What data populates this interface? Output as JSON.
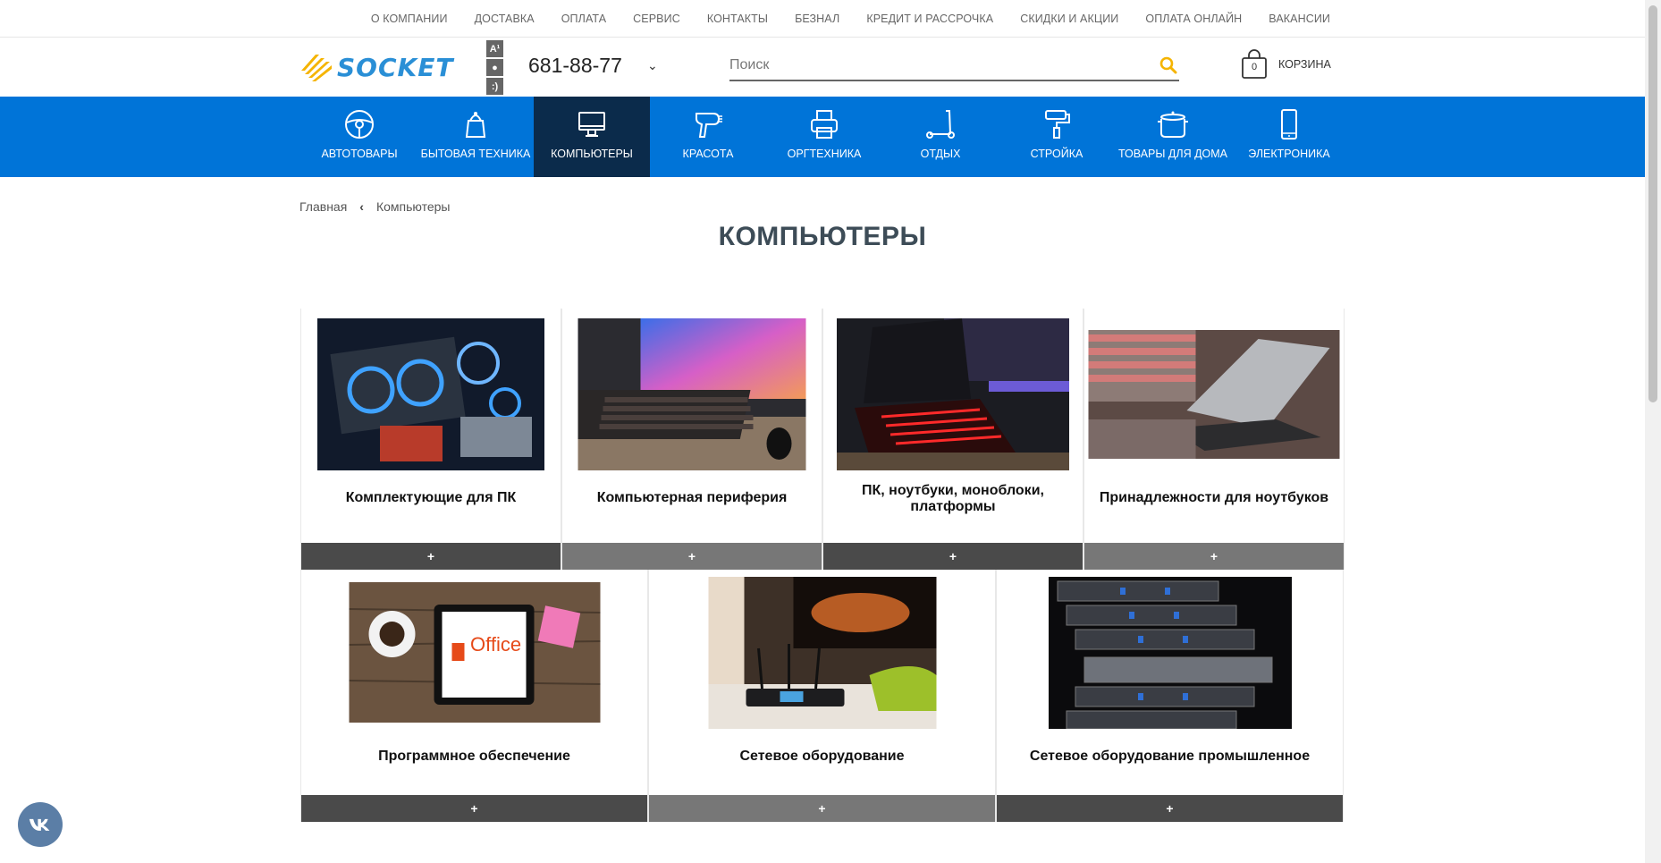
{
  "top_links": [
    "О КОМПАНИИ",
    "ДОСТАВКА",
    "ОПЛАТА",
    "СЕРВИС",
    "КОНТАКТЫ",
    "БЕЗНАЛ",
    "КРЕДИТ И РАССРОЧКА",
    "СКИДКИ И АКЦИИ",
    "ОПЛАТА ОНЛАЙН",
    "ВАКАНСИИ"
  ],
  "header": {
    "logo_text": "SOCKET",
    "operators": [
      "A¹",
      "●",
      ":)"
    ],
    "phone": "681-88-77",
    "search_placeholder": "Поиск",
    "cart_count": "0",
    "cart_label": "КОРЗИНА"
  },
  "nav": [
    {
      "label": "АВТОТОВАРЫ",
      "icon": "steering-wheel-icon"
    },
    {
      "label": "БЫТОВАЯ ТЕХНИКА",
      "icon": "kettle-icon"
    },
    {
      "label": "КОМПЬЮТЕРЫ",
      "icon": "monitor-icon",
      "active": true
    },
    {
      "label": "КРАСОТА",
      "icon": "hair-dryer-icon"
    },
    {
      "label": "ОРГТЕХНИКА",
      "icon": "printer-icon"
    },
    {
      "label": "ОТДЫХ",
      "icon": "scooter-icon"
    },
    {
      "label": "СТРОЙКА",
      "icon": "paint-roller-icon"
    },
    {
      "label": "ТОВАРЫ ДЛЯ ДОМА",
      "icon": "pot-icon"
    },
    {
      "label": "ЭЛЕКТРОНИКА",
      "icon": "smartphone-icon"
    }
  ],
  "breadcrumb": {
    "home": "Главная",
    "current": "Компьютеры"
  },
  "page_title": "КОМПЬЮТЕРЫ",
  "categories_row1": [
    {
      "name": "Комплектующие для ПК",
      "plus": "+"
    },
    {
      "name": "Компьютерная периферия",
      "plus": "+"
    },
    {
      "name": "ПК, ноутбуки, моноблоки, платформы",
      "plus": "+"
    },
    {
      "name": "Принадлежности для ноутбуков",
      "plus": "+"
    }
  ],
  "categories_row2": [
    {
      "name": "Программное обеспечение",
      "plus": "+",
      "image_text": "Office"
    },
    {
      "name": "Сетевое оборудование",
      "plus": "+"
    },
    {
      "name": "Сетевое оборудование промышленное",
      "plus": "+"
    }
  ],
  "social": {
    "vk": "vk"
  },
  "colors": {
    "nav_bg": "#0074d8",
    "nav_active": "#0b2b4b",
    "accent": "#f5b400",
    "title": "#3d4c57"
  }
}
